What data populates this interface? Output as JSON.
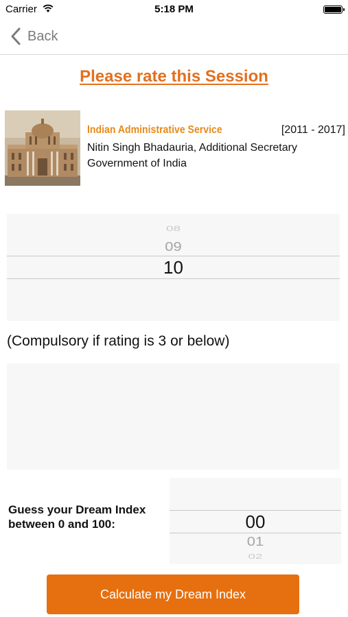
{
  "status_bar": {
    "carrier": "Carrier",
    "time": "5:18 PM",
    "battery": "full"
  },
  "nav": {
    "back_label": "Back"
  },
  "page": {
    "title": "Please rate this Session"
  },
  "session": {
    "service": "Indian Administrative Service",
    "years": "[2011 - 2017]",
    "speaker": "Nitin Singh Bhadauria, Additional Secretary",
    "organization": "Government of India",
    "photo_icon": "government-building-photo"
  },
  "rating_picker": {
    "options": [
      "08",
      "09",
      "10"
    ],
    "selected": "10"
  },
  "comment": {
    "note": "(Compulsory if rating is 3 or below)",
    "value": ""
  },
  "dream_index": {
    "label": "Guess your Dream Index between 0 and 100:",
    "options": [
      "00",
      "01",
      "02"
    ],
    "selected": "00"
  },
  "actions": {
    "calculate_label": "Calculate my Dream Index"
  },
  "colors": {
    "accent": "#e2701e",
    "button": "#e6700f",
    "service_text": "#e88a1a"
  }
}
